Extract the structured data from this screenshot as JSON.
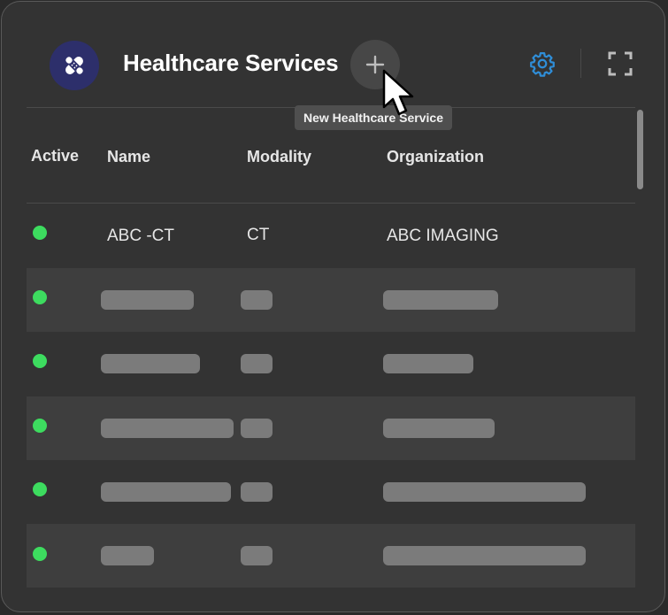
{
  "header": {
    "logo_icon": "bandage-icon",
    "title": "Healthcare Services",
    "add_icon": "plus-icon",
    "add_tooltip": "New Healthcare Service",
    "settings_icon": "gear-icon",
    "fullscreen_icon": "fullscreen-icon"
  },
  "table": {
    "columns": [
      "Active",
      "Name",
      "Modality",
      "Organization"
    ],
    "rows": [
      {
        "active": true,
        "name": "ABC -CT",
        "modality": "CT",
        "organization": "ABC IMAGING"
      },
      {
        "active": true,
        "name": "",
        "modality": "",
        "organization": "",
        "redacted": true
      },
      {
        "active": true,
        "name": "",
        "modality": "",
        "organization": "",
        "redacted": true
      },
      {
        "active": true,
        "name": "",
        "modality": "",
        "organization": "",
        "redacted": true
      },
      {
        "active": true,
        "name": "",
        "modality": "",
        "organization": "",
        "redacted": true
      },
      {
        "active": true,
        "name": "",
        "modality": "",
        "organization": "",
        "redacted": true
      }
    ]
  },
  "colors": {
    "panel_bg": "#333333",
    "active_dot": "#3ddc5f",
    "accent": "#2f8ed8",
    "logo_bg": "#2d2f6b"
  }
}
